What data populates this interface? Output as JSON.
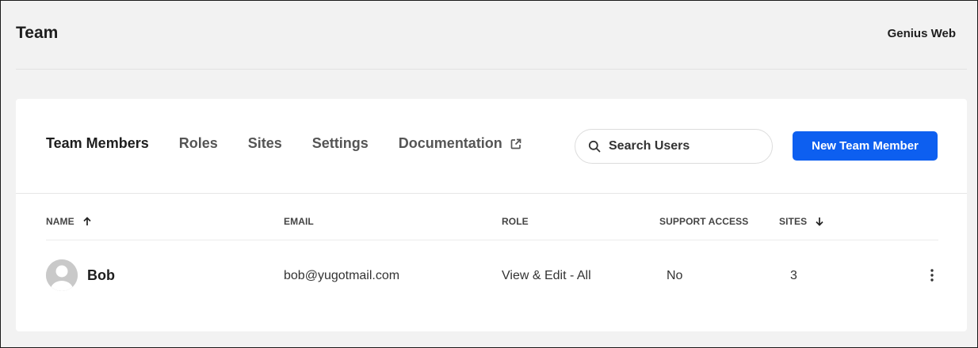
{
  "header": {
    "title": "Team",
    "account_name": "Genius Web"
  },
  "tabs": [
    {
      "label": "Team Members",
      "active": true
    },
    {
      "label": "Roles"
    },
    {
      "label": "Sites"
    },
    {
      "label": "Settings"
    },
    {
      "label": "Documentation",
      "icon": "external-link-icon"
    }
  ],
  "search": {
    "placeholder": "Search Users",
    "value": "",
    "icon": "search-icon"
  },
  "new_button": {
    "label": "New Team Member",
    "color": "#0d5ff0"
  },
  "table": {
    "columns": [
      {
        "label": "NAME",
        "sort": "asc"
      },
      {
        "label": "EMAIL"
      },
      {
        "label": "ROLE"
      },
      {
        "label": "SUPPORT ACCESS"
      },
      {
        "label": "SITES",
        "sort": "desc"
      }
    ],
    "rows": [
      {
        "name": "Bob",
        "email": "bob@yugotmail.com",
        "role": "View & Edit - All",
        "support_access": "No",
        "sites": "3",
        "avatar": "default-avatar-icon"
      }
    ]
  }
}
